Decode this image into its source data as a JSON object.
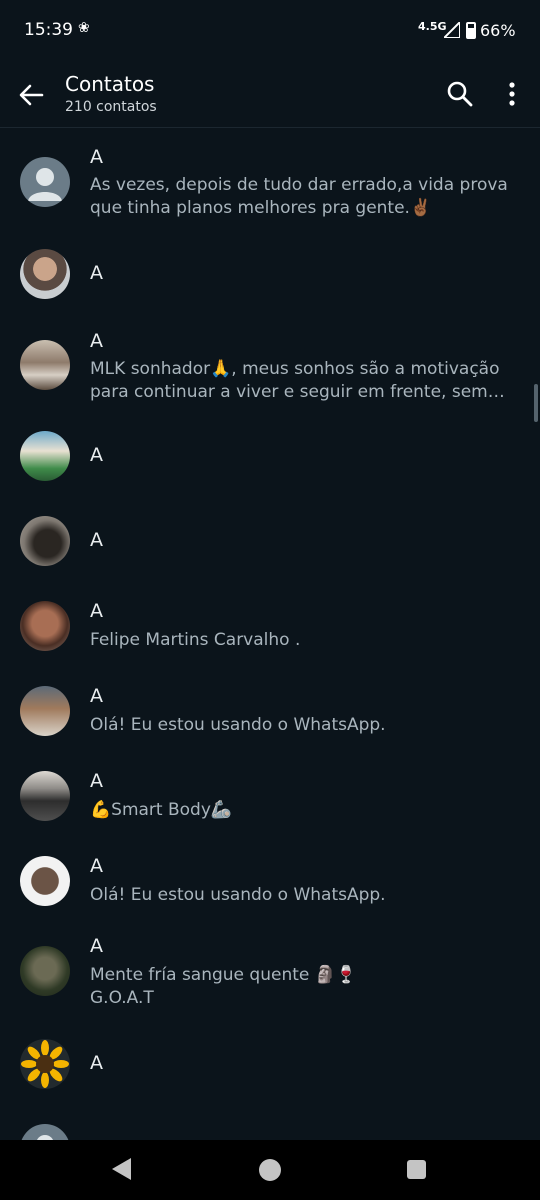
{
  "status_bar": {
    "time": "15:39",
    "network": "4.5G",
    "battery": "66%",
    "icons": [
      "app-notification-icon",
      "signal-icon",
      "battery-icon"
    ]
  },
  "app_bar": {
    "title": "Contatos",
    "subtitle": "210 contatos",
    "icons": [
      "back-arrow-icon",
      "search-icon",
      "more-vert-icon"
    ]
  },
  "contacts": [
    {
      "name": "A",
      "status": "As vezes, depois de tudo dar errado,a vida prova que tinha planos melhores pra gente.✌🏾"
    },
    {
      "name": "A",
      "status": ""
    },
    {
      "name": "A",
      "status": "MLK sonhador🙏, meus sonhos são a motivação para continuar a viver e seguir em frente, sem eles não sou nada"
    },
    {
      "name": "A",
      "status": ""
    },
    {
      "name": "A",
      "status": ""
    },
    {
      "name": "A",
      "status": "Felipe Martins Carvalho ."
    },
    {
      "name": "A",
      "status": "Olá! Eu estou usando o WhatsApp."
    },
    {
      "name": "A",
      "status": "💪Smart Body🦾"
    },
    {
      "name": "A",
      "status": "Olá! Eu estou usando o WhatsApp."
    },
    {
      "name": "A",
      "status": "Mente fría sangue quente 🗿🍷\nG.O.A.T"
    },
    {
      "name": "A",
      "status": ""
    }
  ],
  "colors": {
    "background": "#0b141b",
    "primary_text": "#e9edef",
    "secondary_text": "#a9b5bd",
    "nav_bar": "#000000"
  },
  "nav_bar": {
    "icons": [
      "nav-back-icon",
      "nav-home-icon",
      "nav-recents-icon"
    ]
  }
}
